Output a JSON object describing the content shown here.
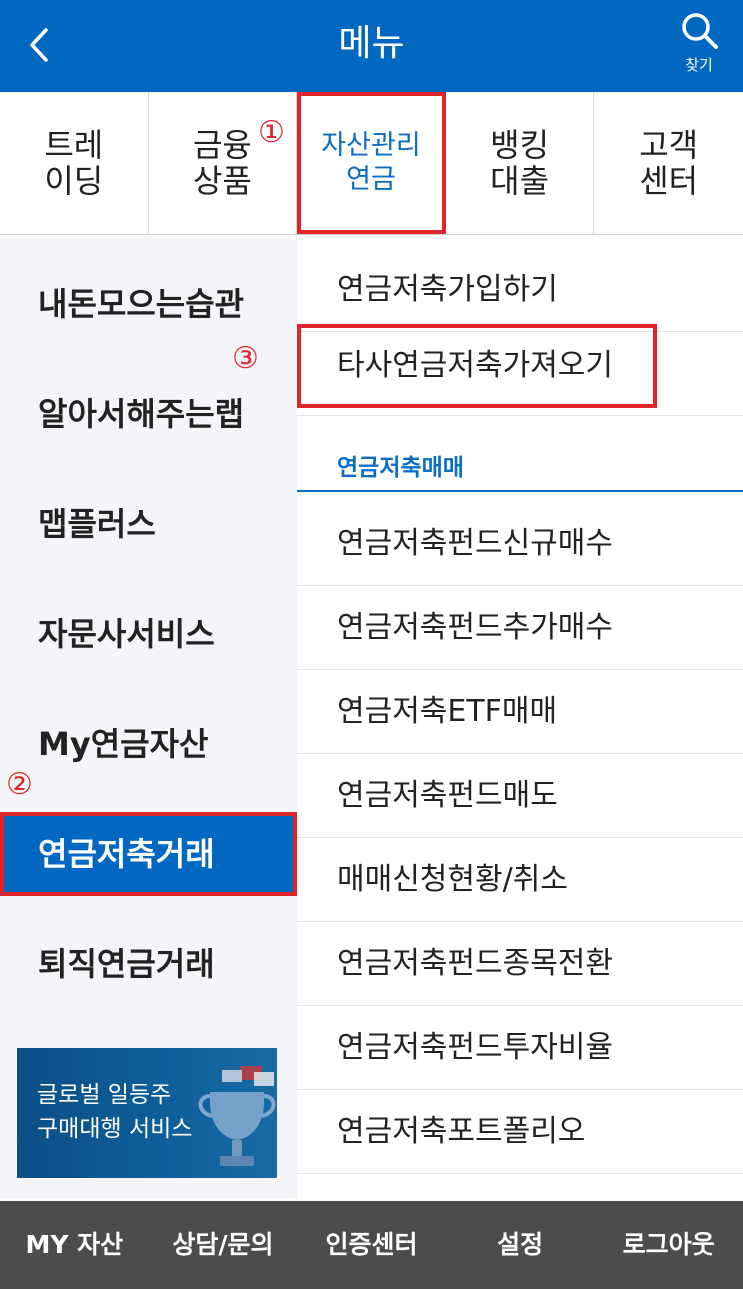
{
  "header": {
    "title": "메뉴",
    "search_label": "찾기",
    "back_icon": "chevron-left-icon",
    "search_icon": "search-icon",
    "color": "#0068c1"
  },
  "tabs": [
    {
      "label": "트레\n이딩"
    },
    {
      "label": "금융\n상품"
    },
    {
      "label": "자산관리\n연금"
    },
    {
      "label": "뱅킹\n대출"
    },
    {
      "label": "고객\n센터"
    }
  ],
  "markers": {
    "one": "①",
    "two": "②",
    "three": "③"
  },
  "sidebar": {
    "items": [
      {
        "label": "내돈모으는습관"
      },
      {
        "label": "알아서해주는랩"
      },
      {
        "label": "맵플러스"
      },
      {
        "label": "자문사서비스"
      },
      {
        "label": "My연금자산"
      },
      {
        "label": "연금저축거래"
      },
      {
        "label": "퇴직연금거래"
      }
    ],
    "banner": "글로벌 일등주\n구매대행 서비스"
  },
  "content": {
    "items_top": [
      {
        "label": "연금저축가입하기"
      },
      {
        "label": "타사연금저축가져오기"
      }
    ],
    "section_title": "연금저축매매",
    "items": [
      {
        "label": "연금저축펀드신규매수"
      },
      {
        "label": "연금저축펀드추가매수"
      },
      {
        "label": "연금저축ETF매매"
      },
      {
        "label": "연금저축펀드매도"
      },
      {
        "label": "매매신청현황/취소"
      },
      {
        "label": "연금저축펀드종목전환"
      },
      {
        "label": "연금저축펀드투자비율"
      },
      {
        "label": "연금저축포트폴리오"
      }
    ]
  },
  "bottom_bar": [
    {
      "label": "MY 자산"
    },
    {
      "label": "상담/문의"
    },
    {
      "label": "인증센터"
    },
    {
      "label": "설정"
    },
    {
      "label": "로그아웃"
    }
  ]
}
